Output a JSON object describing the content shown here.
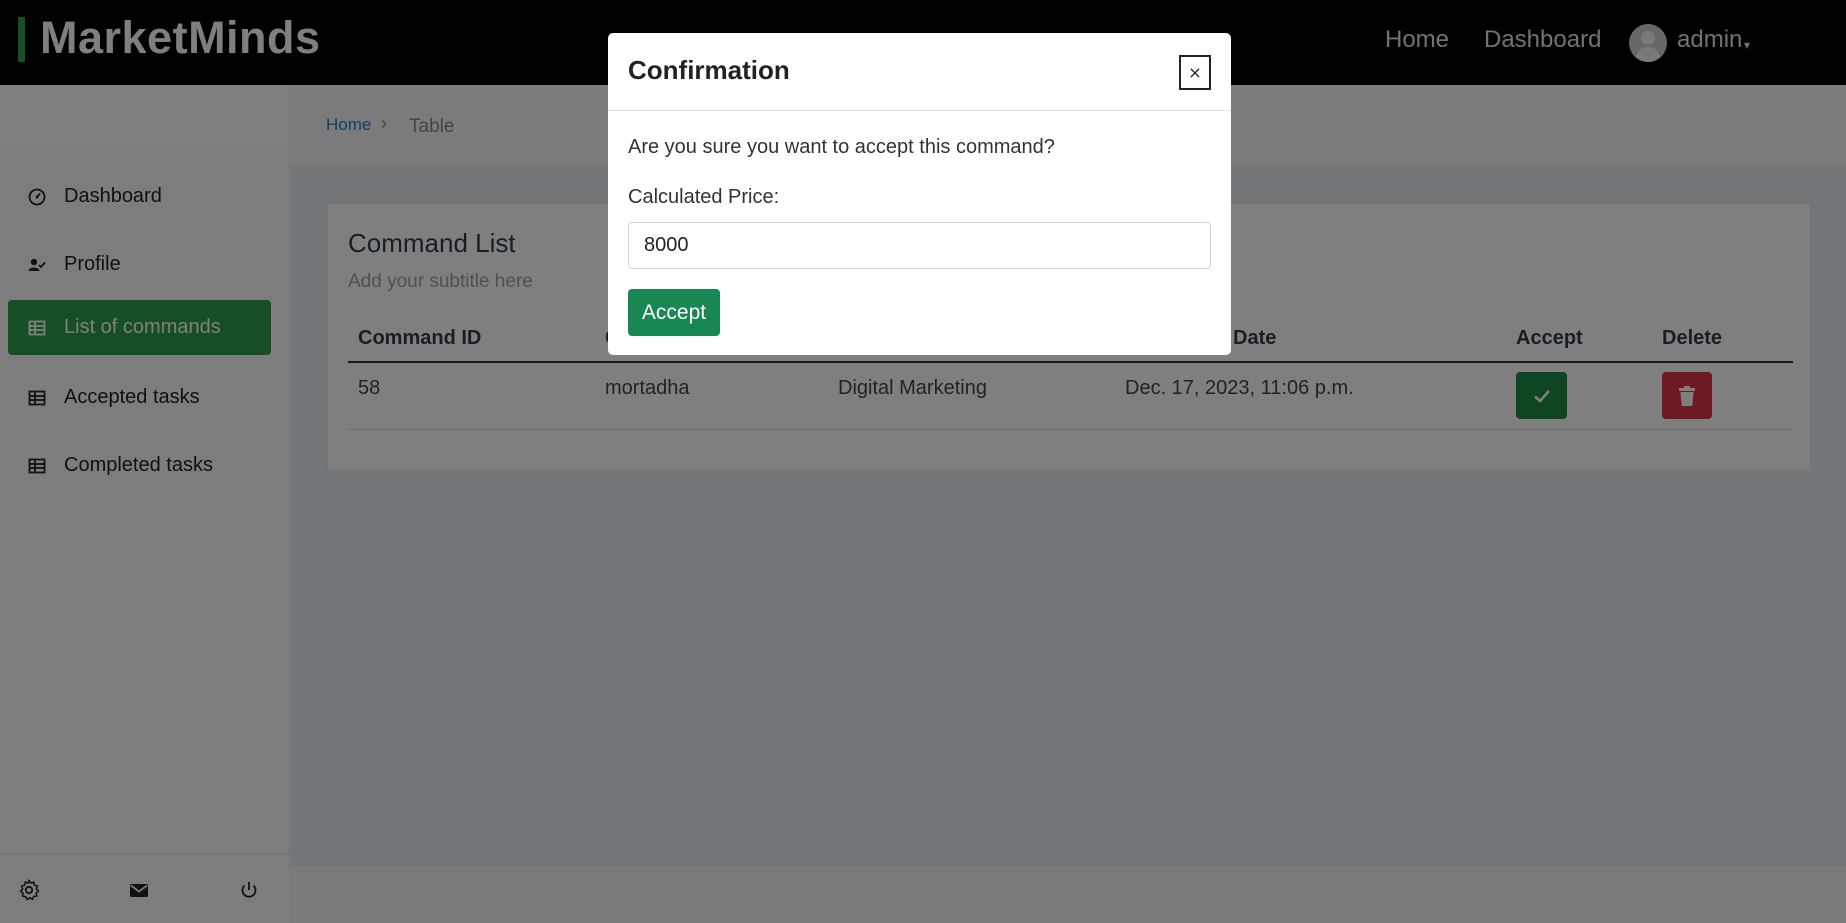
{
  "app": {
    "brand": "MarketMinds",
    "accent_color": "#2e9e4a"
  },
  "topnav": {
    "home": "Home",
    "dashboard": "Dashboard",
    "user": "admin",
    "caret": "▾"
  },
  "sidebar": {
    "items": [
      {
        "label": "Dashboard",
        "icon": "dashboard-icon",
        "active": false
      },
      {
        "label": "Profile",
        "icon": "user-check-icon",
        "active": false
      },
      {
        "label": "List of commands",
        "icon": "table-icon",
        "active": true
      },
      {
        "label": "Accepted tasks",
        "icon": "table-icon",
        "active": false
      },
      {
        "label": "Completed tasks",
        "icon": "table-icon",
        "active": false
      }
    ],
    "footer_icons": [
      "settings-icon",
      "mail-icon",
      "power-icon"
    ]
  },
  "breadcrumb": {
    "home": "Home",
    "separator": "›",
    "current": "Table"
  },
  "card": {
    "title": "Command List",
    "subtitle": "Add your subtitle here",
    "headers": [
      "Command ID",
      "C",
      "Date",
      "Accept",
      "Delete"
    ],
    "rows": [
      {
        "id": "58",
        "client": "mortadha",
        "service": "Digital Marketing",
        "date": "Dec. 17, 2023, 11:06 p.m."
      }
    ]
  },
  "modal": {
    "title": "Confirmation",
    "close": "×",
    "question": "Are you sure you want to accept this command?",
    "price_label": "Calculated Price:",
    "price_value": "8000",
    "accept_button": "Accept"
  }
}
